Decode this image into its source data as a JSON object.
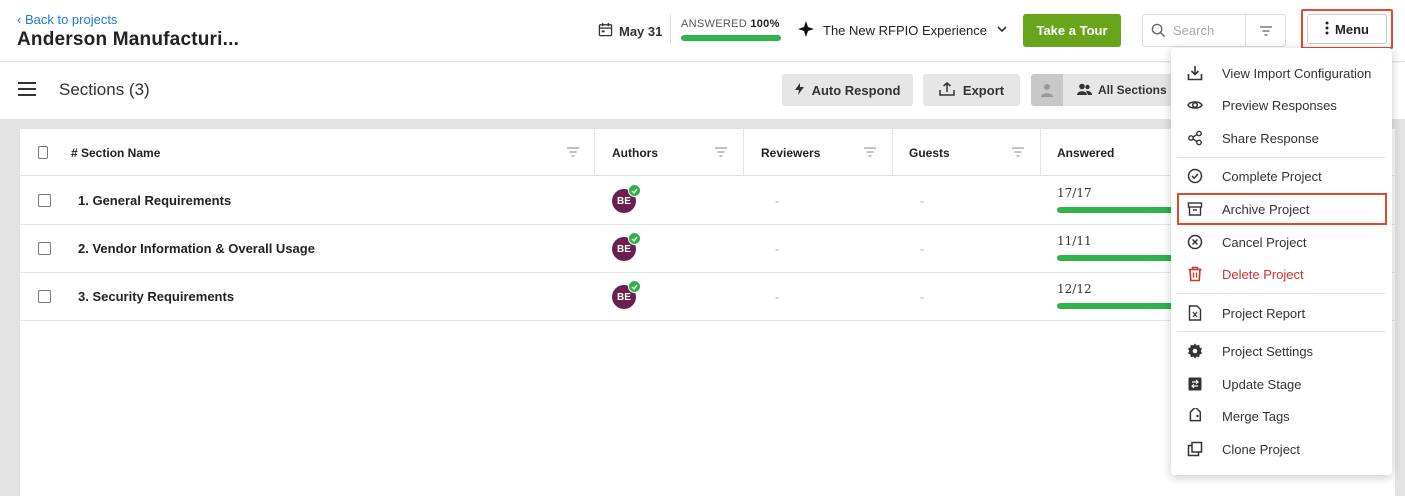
{
  "header": {
    "back_label": "‹ Back to projects",
    "project_title": "Anderson Manufacturi...",
    "due_date": "May 31",
    "answered_label": "ANSWERED",
    "answered_pct": "100%",
    "answered_fraction": 1.0,
    "project_type": "The New RFPIO Experience",
    "tour_label": "Take a Tour",
    "search_placeholder": "Search",
    "menu_label": "Menu",
    "colors": {
      "progress": "#2db34a",
      "tour": "#69a51c",
      "highlight": "#e04a2f",
      "link": "#1d7bd8"
    }
  },
  "toolbar": {
    "sections_title": "Sections (3)",
    "auto_respond_label": "Auto Respond",
    "export_label": "Export",
    "all_sections_label": "All Sections"
  },
  "table": {
    "columns": {
      "name": "# Section Name",
      "authors": "Authors",
      "reviewers": "Reviewers",
      "guests": "Guests",
      "answered": "Answered"
    },
    "rows": [
      {
        "name": "1. General Requirements",
        "author_initials": "BE",
        "reviewers": "-",
        "guests": "-",
        "answered": "17/17",
        "answered_fraction": 1.0
      },
      {
        "name": "2. Vendor Information & Overall Usage",
        "author_initials": "BE",
        "reviewers": "-",
        "guests": "-",
        "answered": "11/11",
        "answered_fraction": 1.0
      },
      {
        "name": "3. Security Requirements",
        "author_initials": "BE",
        "reviewers": "-",
        "guests": "-",
        "answered": "12/12",
        "answered_fraction": 1.0
      }
    ]
  },
  "menu": {
    "items": [
      {
        "label": "View Import Configuration",
        "icon": "import-icon"
      },
      {
        "label": "Preview Responses",
        "icon": "eye-icon"
      },
      {
        "label": "Share Response",
        "icon": "share-icon"
      },
      {
        "label": "Complete Project",
        "icon": "check-circle-icon"
      },
      {
        "label": "Archive Project",
        "icon": "archive-icon"
      },
      {
        "label": "Cancel Project",
        "icon": "cancel-circle-icon"
      },
      {
        "label": "Delete Project",
        "icon": "trash-icon"
      },
      {
        "label": "Project Report",
        "icon": "report-icon"
      },
      {
        "label": "Project Settings",
        "icon": "gear-icon"
      },
      {
        "label": "Update Stage",
        "icon": "stage-icon"
      },
      {
        "label": "Merge Tags",
        "icon": "tag-icon"
      },
      {
        "label": "Clone Project",
        "icon": "clone-icon"
      }
    ]
  }
}
